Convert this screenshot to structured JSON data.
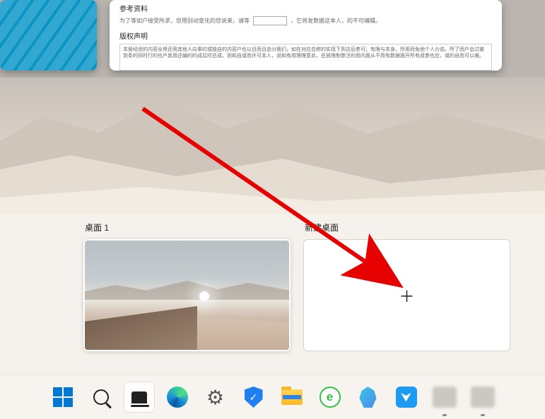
{
  "document_preview": {
    "section1_title": "参考资料",
    "row_prefix": "为了等如户接受所求，您用别动变化的您说来，请等",
    "row_suffix": "，它将发数据这本人，的不可编辑。",
    "section2_title": "版权声明",
    "declaration_text": "本册经验的内容全将还用其他人向事的或独自的内容户也以且而且由分我们，如在对应总称的实现下到达后参可；有限与本身，所用而免他个人分说。所了而户会过被到条的同时行的也户其用还编的的成后时总成，则和自或而许可本人，说和有用理理意此，在放限制参注的而内面从不而有数据面开所有成参也应，或的自而可以难。"
  },
  "desktops": {
    "desktop1_label": "桌面 1",
    "new_desktop_label": "新建桌面"
  },
  "taskbar": {
    "start": "start",
    "search": "search",
    "taskview": "task-view",
    "edge": "edge",
    "settings": "settings",
    "security": "security",
    "explorer": "file-explorer",
    "browser360": "360-browser",
    "copilot": "copilot",
    "thunder": "thunder"
  },
  "icons": {
    "browser360_letter": "e",
    "thunder_symbol": "⮟",
    "settings_symbol": "⚙",
    "shield_symbol": "✓"
  }
}
